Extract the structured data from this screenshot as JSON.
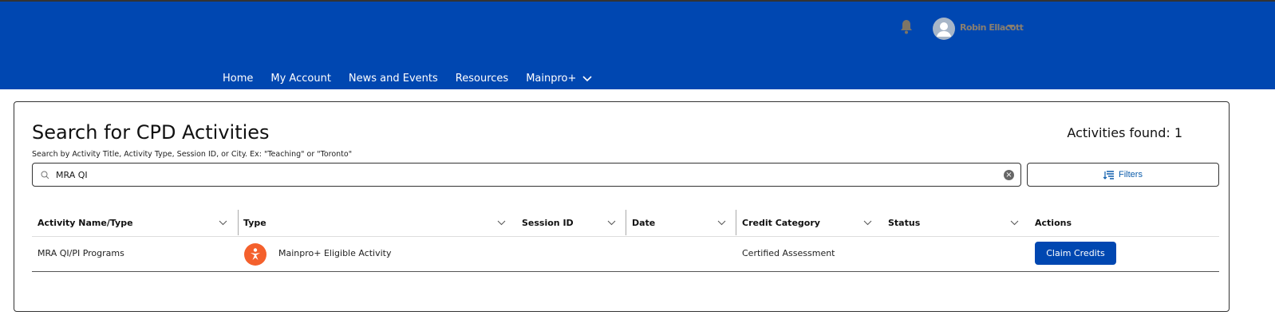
{
  "header": {
    "user_name": "Robin Ellacott",
    "brand_color": "#0047b1"
  },
  "nav": {
    "items": [
      "Home",
      "My Account",
      "News and Events",
      "Resources",
      "Mainpro+"
    ]
  },
  "page": {
    "title": "Search for CPD Activities",
    "activities_found": "Activities found: 1",
    "hint": "Search by Activity Title, Activity Type, Session ID, or City. Ex: \"Teaching\" or \"Toronto\"",
    "search_value": "MRA QI",
    "filters_label": "Filters"
  },
  "table": {
    "columns": [
      "Activity Name/Type",
      "Type",
      "Session ID",
      "Date",
      "Credit Category",
      "Status",
      "Actions"
    ],
    "rows": [
      {
        "name": "MRA QI/PI Programs",
        "type": "Mainpro+ Eligible Activity",
        "session_id": "",
        "date": "",
        "credit_category": "Certified Assessment",
        "status": "",
        "action": "Claim Credits",
        "type_icon_color": "#f4602c"
      }
    ]
  }
}
